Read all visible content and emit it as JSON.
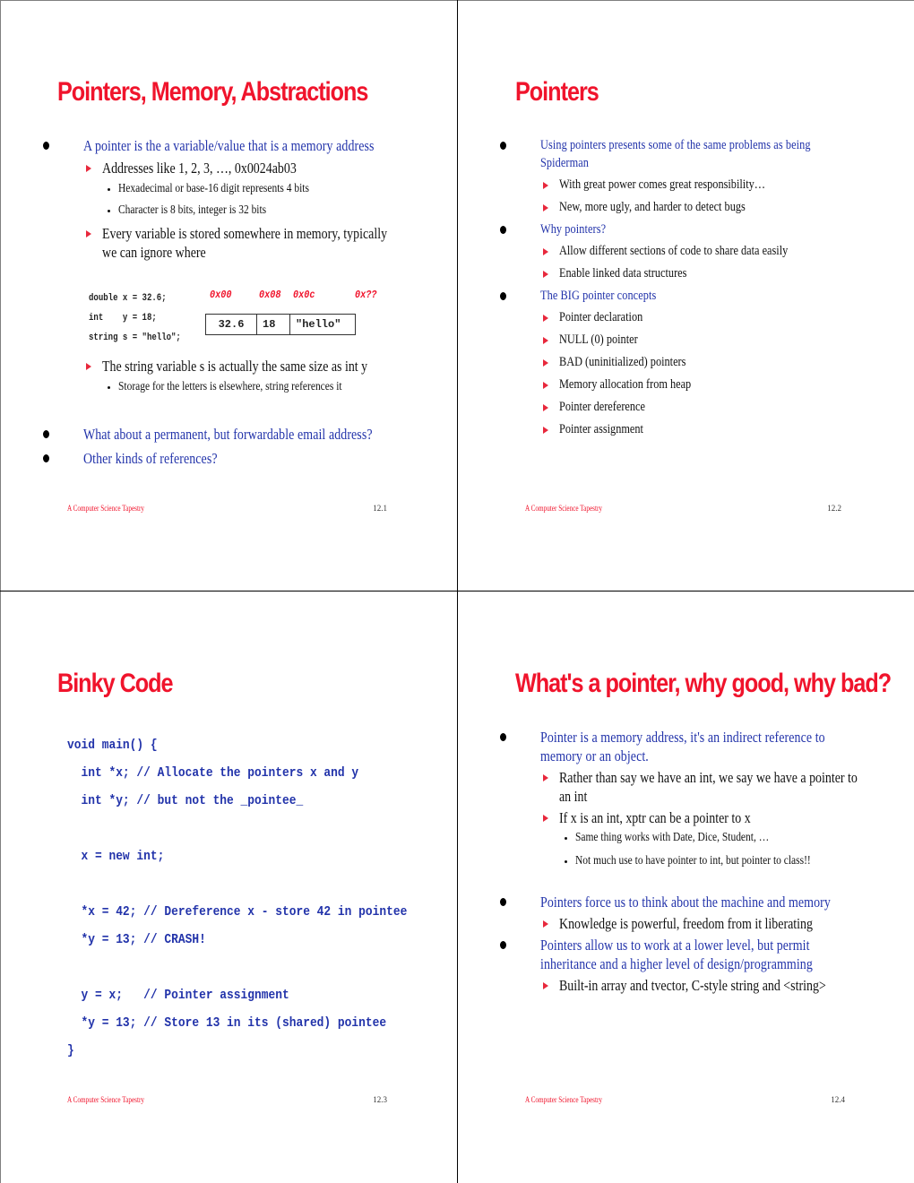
{
  "slides": [
    {
      "title": "Pointers, Memory, Abstractions",
      "bullets_top": {
        "b1": "A pointer is the a variable/value that is a memory address",
        "b1_sub1": "Addresses like 1, 2, 3, …, 0x0024ab03",
        "b1_sub1_sub1": "Hexadecimal or base-16 digit represents 4 bits",
        "b1_sub1_sub2": "Character is 8 bits, integer is 32 bits",
        "b1_sub2": "Every variable is stored somewhere in memory, typically we can ignore where"
      },
      "code": [
        "double x = 32.6;",
        "int    y = 18;",
        "string s = \"hello\";"
      ],
      "addresses": [
        "0x00",
        "0x08",
        "0x0c",
        "0x??"
      ],
      "memory_cells": [
        "32.6",
        "18",
        "\"hello\""
      ],
      "after_code": {
        "sub": "The string variable s is actually the same size as int y",
        "subsub": "Storage for the letters is elsewhere, string references it"
      },
      "bullets_bottom": [
        "What about a permanent, but forwardable email address?",
        "Other kinds of references?"
      ],
      "footer": "A Computer Science Tapestry",
      "page": "12.1"
    },
    {
      "title": "Pointers",
      "b1": "Using pointers presents some of the same problems as being Spiderman",
      "b1_subs": [
        "With great power comes great responsibility…",
        "New, more ugly, and harder to detect bugs"
      ],
      "b2": "Why pointers?",
      "b2_subs": [
        "Allow different sections of code to share data easily",
        "Enable linked data structures"
      ],
      "b3": "The BIG pointer concepts",
      "b3_subs": [
        "Pointer declaration",
        "NULL (0) pointer",
        "BAD (uninitialized) pointers",
        "Memory allocation from heap",
        "Pointer dereference",
        "Pointer assignment"
      ],
      "footer": "A Computer Science Tapestry",
      "page": "12.2"
    },
    {
      "title": "Binky Code",
      "code": [
        "void main() {",
        "  int *x; // Allocate the pointers x and y",
        "  int *y; // but not the _pointee_",
        "",
        "  x = new int;",
        "",
        "  *x = 42; // Dereference x - store 42 in pointee",
        "  *y = 13; // CRASH!",
        "",
        "  y = x;   // Pointer assignment",
        "  *y = 13; // Store 13 in its (shared) pointee",
        "}"
      ],
      "footer": "A Computer Science Tapestry",
      "page": "12.3"
    },
    {
      "title": "What's a pointer, why good, why bad?",
      "b1": "Pointer is a memory address, it's an indirect reference to memory or an object.",
      "b1_sub1": "Rather than say we have an int, we say we have a pointer to an int",
      "b1_sub2": "If x is an int, xptr can be a pointer to x",
      "b1_sub2_subs": [
        "Same thing works with Date, Dice, Student, …",
        "Not much use to have pointer to int, but pointer to class!!"
      ],
      "b2": "Pointers force us to think about the machine and memory",
      "b2_sub": "Knowledge is powerful, freedom from it liberating",
      "b3": "Pointers allow us to work at a lower level, but permit inheritance and a higher level of design/programming",
      "b3_sub": "Built-in array and tvector, C-style string and <string>",
      "footer": "A Computer Science Tapestry",
      "page": "12.4"
    }
  ]
}
